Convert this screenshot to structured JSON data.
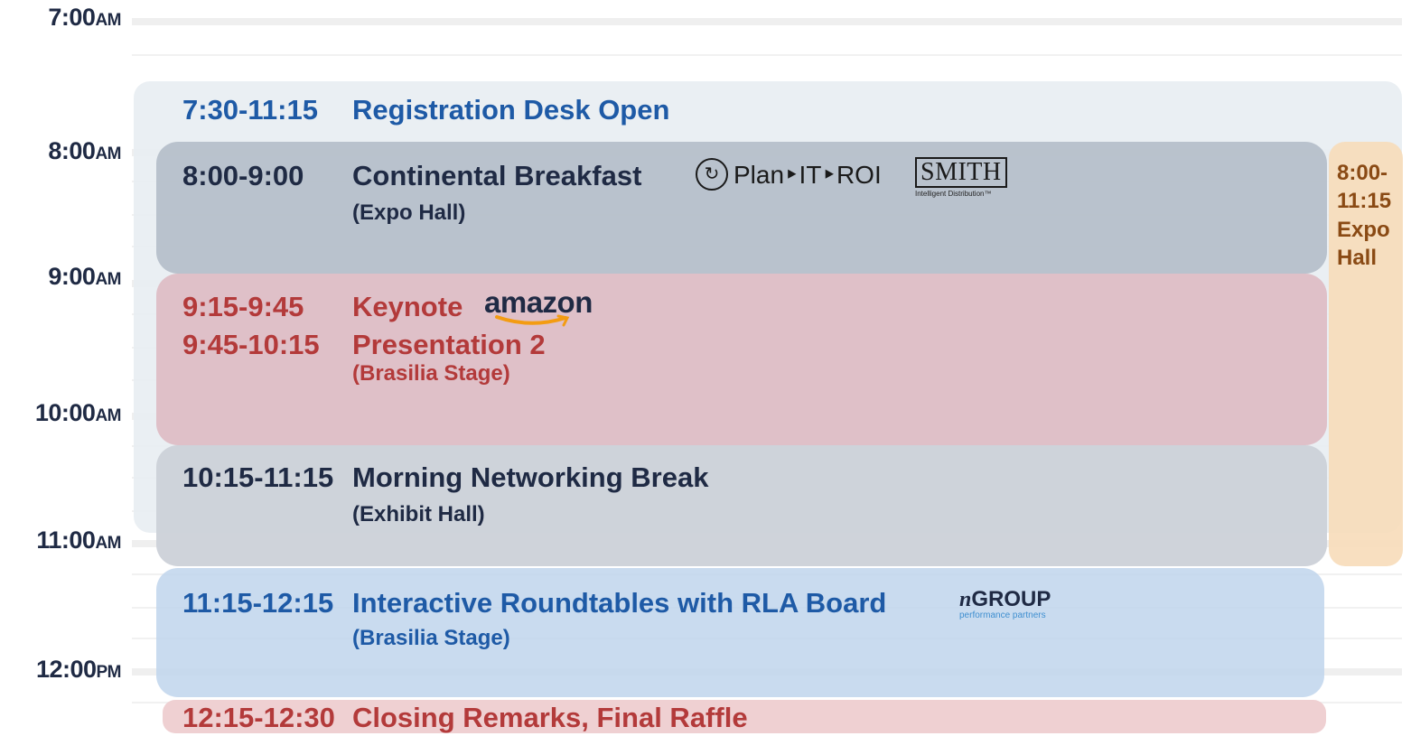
{
  "hours": [
    {
      "time": "7:00",
      "ampm": "AM"
    },
    {
      "time": "8:00",
      "ampm": "AM"
    },
    {
      "time": "9:00",
      "ampm": "AM"
    },
    {
      "time": "10:00",
      "ampm": "AM"
    },
    {
      "time": "11:00",
      "ampm": "AM"
    },
    {
      "time": "12:00",
      "ampm": "PM"
    }
  ],
  "events": {
    "registration": {
      "time": "7:30-11:15",
      "title": "Registration Desk Open"
    },
    "breakfast": {
      "time": "8:00-9:00",
      "title": "Continental Breakfast",
      "location": "(Expo Hall)"
    },
    "keynote": {
      "time": "9:15-9:45",
      "title": "Keynote"
    },
    "presentation2": {
      "time": "9:45-10:15",
      "title": "Presentation 2",
      "location": "(Brasilia Stage)"
    },
    "networking": {
      "time": "10:15-11:15",
      "title": "Morning Networking Break",
      "location": "(Exhibit Hall)"
    },
    "roundtables": {
      "time": "11:15-12:15",
      "title": "Interactive Roundtables with RLA Board",
      "location": "(Brasilia Stage)"
    },
    "closing": {
      "time": "12:15-12:30",
      "title": "Closing Remarks, Final Raffle"
    },
    "expo": {
      "time": "8:00-11:15",
      "title": "Expo Hall"
    }
  },
  "sponsors": {
    "planit": "Plan‣IT‣ROI",
    "smith": "SMITH",
    "smith_tagline": "Intelligent Distribution™",
    "amazon": "amazon",
    "ngroup": "GROUP",
    "ngroup_prefix": "n",
    "ngroup_tagline": "performance partners"
  },
  "colors": {
    "registration": "#e8edf2",
    "breakfast": "#b0bac6",
    "keynote": "#ddbcc4",
    "networking": "#ccd1d8",
    "roundtables": "#c0d5ec",
    "closing": "#eeced0",
    "expo": "#f7dcb9",
    "blue_text": "#1e5aa6",
    "red_text": "#b33a3a",
    "dark_text": "#1f2a44",
    "expo_text": "#8a4a14"
  }
}
